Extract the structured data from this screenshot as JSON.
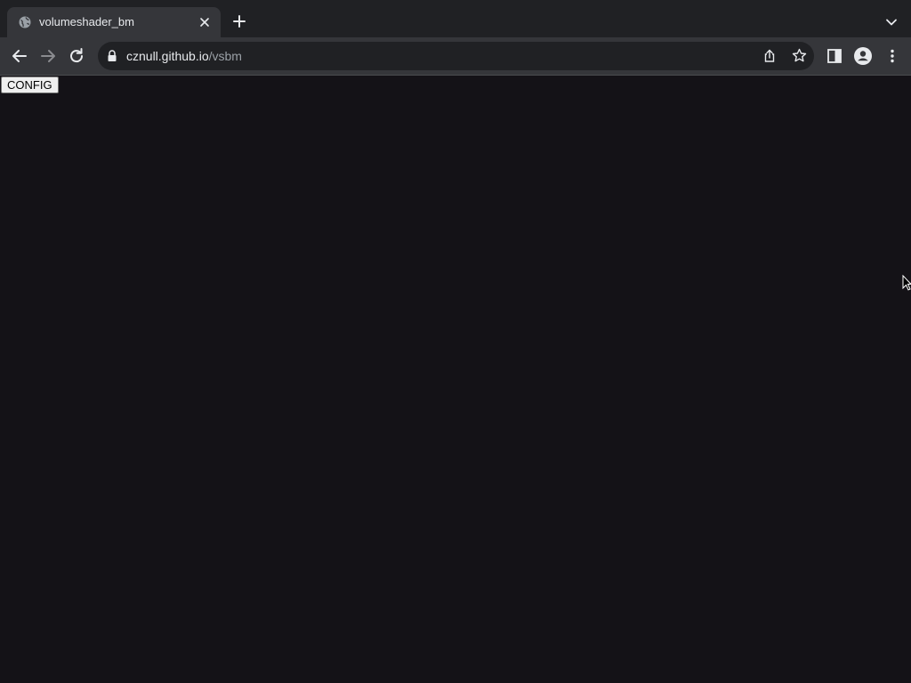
{
  "tab": {
    "title": "volumeshader_bm",
    "favicon_icon": "globe-icon"
  },
  "toolbar": {
    "url_host": "cznull.github.io",
    "url_path": "/vsbm"
  },
  "page": {
    "config_label": "CONFIG"
  },
  "colors": {
    "page_background": "#141217",
    "tabstrip": "#202124",
    "toolbar": "#35363a",
    "omnibox": "#202124"
  }
}
